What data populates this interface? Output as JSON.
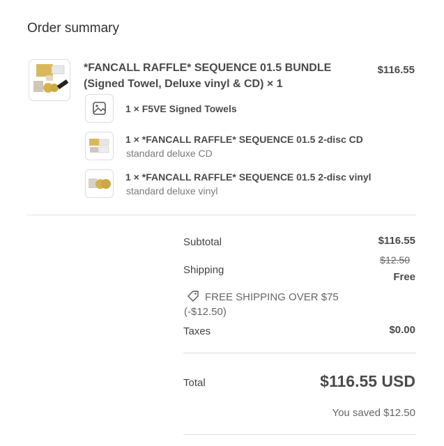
{
  "summary": {
    "title": "Order summary"
  },
  "main_item": {
    "name": "*FANCALL RAFFLE* SEQUENCE 01.5 BUNDLE (Signed Towel, Deluxe vinyl & CD) × 1",
    "price": "$116.55",
    "thumb_icon": "product-bundle-image"
  },
  "sub_items": [
    {
      "line": "1 × F5VE Signed Towels",
      "variant": "",
      "icon": "image-placeholder-icon"
    },
    {
      "line": "1 × *FANCALL RAFFLE* SEQUENCE 01.5 2-disc CD",
      "variant": "standard deluxe CD",
      "icon": "cd-product-image"
    },
    {
      "line": "1 × *FANCALL RAFFLE* SEQUENCE 01.5 2-disc vinyl",
      "variant": "standard deluxe vinyl",
      "icon": "vinyl-product-image"
    }
  ],
  "totals": {
    "subtotal_label": "Subtotal",
    "subtotal_value": "$116.55",
    "shipping_label": "Shipping",
    "shipping_original": "$12.50",
    "shipping_value": "Free",
    "discount_text": "FREE SHIPPING OVER $75",
    "discount_amount": "(-$12.50)",
    "taxes_label": "Taxes",
    "taxes_value": "$0.00",
    "total_label": "Total",
    "total_value": "$116.55 USD",
    "saved_text": "You saved $12.50"
  },
  "colors": {
    "text": "#303030",
    "muted": "#7a7a7a",
    "border": "#dcdcdc",
    "gold": "#c9a84a"
  }
}
